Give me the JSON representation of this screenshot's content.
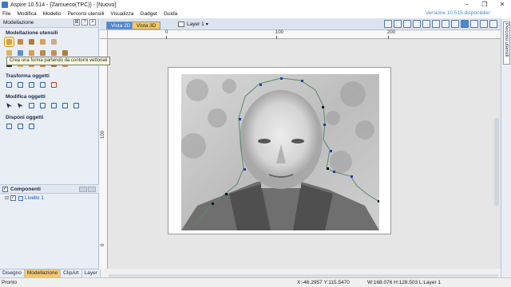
{
  "window": {
    "title": "Aspire 10.514 - {Zamueco(TPC)} - [Nuovo]",
    "controls": [
      "–",
      "❐",
      "✕"
    ]
  },
  "menu": {
    "items": [
      "File",
      "Modifica",
      "Modello",
      "Percorsi utensili",
      "Visualizza",
      "Gadget",
      "Guida"
    ],
    "version_notice": "Versione 10.515 disponibile!"
  },
  "left_panel": {
    "header": "Modellazione",
    "header_controls": [
      "⊞",
      "?",
      "×"
    ],
    "sections": {
      "modellazione_utensili": "Modellazione utensili",
      "trasforma_oggetti": "Trasforma oggetti",
      "modifica_oggetti": "Modifica oggetti",
      "disponi_oggetti": "Disponi oggetti"
    },
    "tooltip": "Crea una forma partendo da contorni vettoriali",
    "components": {
      "title": "Componenti",
      "layer_name": "Livello 1"
    },
    "tabs": [
      "Disegno",
      "Modellazione",
      "ClipArt",
      "Layer"
    ]
  },
  "view": {
    "tab_2d": "Vista 2D",
    "tab_3d": "Vista 3D",
    "layer_selector": "Layer 1",
    "ruler_x": [
      "0",
      "100",
      "200"
    ],
    "ruler_y": [
      "100",
      "0"
    ]
  },
  "right_panel": {
    "tab_label": "Percorsi utensili"
  },
  "status": {
    "ready": "Pronto",
    "coords": "X:-46.2957 Y:115.5470",
    "size": "W:168.076   H:128.503  L:Layer 1"
  },
  "colors": {
    "accent_blue": "#4b86d5",
    "accent_orange": "#f9c95c",
    "version_link": "#3a8ad8"
  }
}
